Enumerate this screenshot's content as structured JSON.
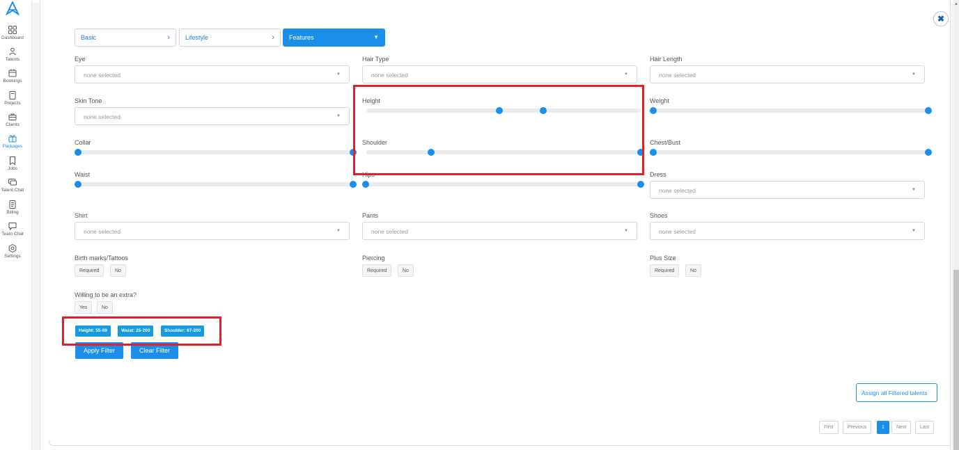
{
  "sidebar": {
    "items": [
      {
        "label": "Dashboard",
        "icon": "dashboard-icon"
      },
      {
        "label": "Talents",
        "icon": "users-icon"
      },
      {
        "label": "Bookings",
        "icon": "calendar-icon"
      },
      {
        "label": "Projects",
        "icon": "projects-icon"
      },
      {
        "label": "Clients",
        "icon": "briefcase-icon"
      },
      {
        "label": "Packages",
        "icon": "gift-icon"
      },
      {
        "label": "Jobs",
        "icon": "bookmark-icon"
      },
      {
        "label": "Talent Chat",
        "icon": "chat-icon"
      },
      {
        "label": "Billing",
        "icon": "billing-icon"
      },
      {
        "label": "Team Chat",
        "icon": "message-icon"
      },
      {
        "label": "Settings",
        "icon": "gear-icon"
      }
    ],
    "active_item": "Packages"
  },
  "steps": [
    {
      "label": "Basic"
    },
    {
      "label": "Lifestyle"
    },
    {
      "label": "Features"
    }
  ],
  "fields": {
    "eye": {
      "label": "Eye",
      "placeholder": "none selected"
    },
    "hair_type": {
      "label": "Hair Type",
      "placeholder": "none selected"
    },
    "hair_length": {
      "label": "Hair Length",
      "placeholder": "none selected"
    },
    "skin_tone": {
      "label": "Skin Tone",
      "placeholder": "none selected"
    },
    "height": {
      "label": "Height",
      "range": [
        55,
        69
      ]
    },
    "weight": {
      "label": "Weight"
    },
    "collar": {
      "label": "Collar"
    },
    "shoulder": {
      "label": "Shoulder",
      "range": [
        67,
        200
      ]
    },
    "chest": {
      "label": "Chest/Bust"
    },
    "waist": {
      "label": "Waist",
      "range": [
        25,
        200
      ]
    },
    "hips": {
      "label": "Hips"
    },
    "dress": {
      "label": "Dress",
      "placeholder": "none selected"
    },
    "shirt": {
      "label": "Shirt",
      "placeholder": "none selected"
    },
    "pants": {
      "label": "Pants",
      "placeholder": "none selected"
    },
    "shoes": {
      "label": "Shoes",
      "placeholder": "none selected"
    },
    "birthmarks": {
      "label": "Birth marks/Tattoos",
      "options": [
        "Required",
        "No"
      ]
    },
    "piercing": {
      "label": "Piercing",
      "options": [
        "Required",
        "No"
      ]
    },
    "plus_size": {
      "label": "Plus Size",
      "options": [
        "Required",
        "No"
      ]
    },
    "extra": {
      "label": "Willing to be an extra?",
      "options": [
        "Yes",
        "No"
      ]
    }
  },
  "active_filters": [
    {
      "label": "Height: 55-69"
    },
    {
      "label": "Waist: 25-200"
    },
    {
      "label": "Shoulder: 67-200"
    }
  ],
  "buttons": {
    "apply": "Apply Filter",
    "clear": "Clear Filter",
    "assign": "Assign all Filtered talents"
  },
  "pagination": {
    "first": "First",
    "previous": "Previous",
    "current": "1",
    "next": "Next",
    "last": "Last"
  },
  "colors": {
    "accent": "#1a8ee8",
    "highlight": "#e3202a"
  },
  "close_symbol": "✖"
}
